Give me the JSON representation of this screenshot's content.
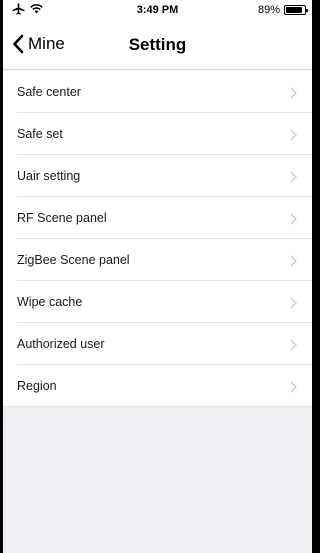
{
  "status_bar": {
    "time": "3:49 PM",
    "battery_percent": "89%",
    "battery_level": 0.89,
    "icons": [
      "airplane-icon",
      "wifi-icon",
      "battery-icon"
    ]
  },
  "nav": {
    "back_label": "Mine",
    "title": "Setting"
  },
  "settings_items": [
    {
      "label": "Safe center"
    },
    {
      "label": "Safe set"
    },
    {
      "label": "Uair setting"
    },
    {
      "label": "RF Scene panel"
    },
    {
      "label": "ZigBee Scene panel"
    },
    {
      "label": "Wipe cache"
    },
    {
      "label": "Authorized user"
    },
    {
      "label": "Region"
    }
  ],
  "colors": {
    "background": "#efeff4",
    "row_background": "#ffffff",
    "chevron": "#c7c7cc"
  }
}
